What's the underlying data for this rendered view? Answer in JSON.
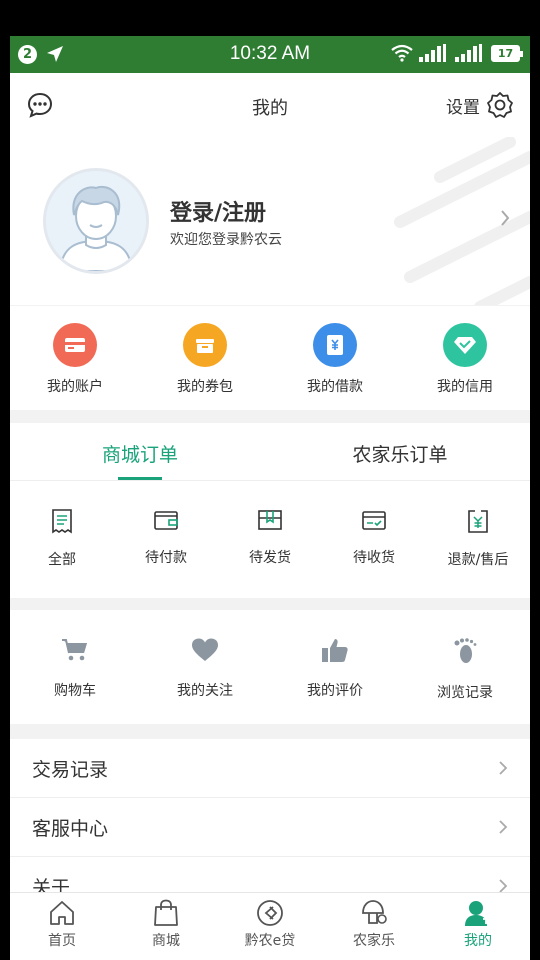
{
  "status_bar": {
    "notification_count": "2",
    "time": "10:32 AM",
    "battery": "17"
  },
  "header": {
    "title": "我的",
    "settings_label": "设置"
  },
  "profile": {
    "name": "登录/注册",
    "welcome": "欢迎您登录黔农云"
  },
  "finance": [
    {
      "label": "我的账户",
      "icon": "card-icon",
      "color": "#f06a55"
    },
    {
      "label": "我的券包",
      "icon": "coupon-icon",
      "color": "#f5a623"
    },
    {
      "label": "我的借款",
      "icon": "loan-icon",
      "color": "#3d8ee8"
    },
    {
      "label": "我的信用",
      "icon": "credit-icon",
      "color": "#2ec4a0"
    }
  ],
  "orders": {
    "tabs": [
      "商城订单",
      "农家乐订单"
    ],
    "active_tab": 0,
    "items": [
      {
        "label": "全部",
        "icon": "receipt-icon"
      },
      {
        "label": "待付款",
        "icon": "wallet-icon"
      },
      {
        "label": "待发货",
        "icon": "package-icon"
      },
      {
        "label": "待收货",
        "icon": "delivery-icon"
      },
      {
        "label": "退款/售后",
        "icon": "refund-icon"
      }
    ]
  },
  "tools": [
    {
      "label": "购物车",
      "icon": "cart-icon"
    },
    {
      "label": "我的关注",
      "icon": "heart-icon"
    },
    {
      "label": "我的评价",
      "icon": "thumbs-up-icon"
    },
    {
      "label": "浏览记录",
      "icon": "footprint-icon"
    }
  ],
  "list": [
    "交易记录",
    "客服中心",
    "关于"
  ],
  "tabbar": {
    "items": [
      {
        "label": "首页",
        "icon": "home-icon"
      },
      {
        "label": "商城",
        "icon": "shopping-bag-icon"
      },
      {
        "label": "黔农e贷",
        "icon": "loan-circle-icon"
      },
      {
        "label": "农家乐",
        "icon": "mushroom-icon"
      },
      {
        "label": "我的",
        "icon": "profile-icon"
      }
    ],
    "active": 4
  },
  "colors": {
    "accent": "#1aa37a",
    "status_bar": "#2e7d32"
  }
}
